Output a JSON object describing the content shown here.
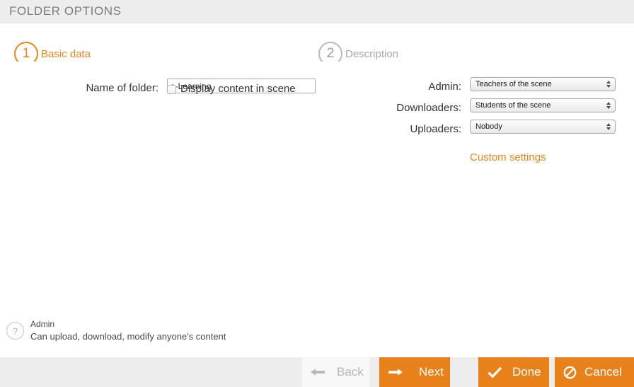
{
  "header": {
    "title": "FOLDER OPTIONS"
  },
  "steps": [
    {
      "number": "1",
      "label": "Basic data",
      "state": "active"
    },
    {
      "number": "2",
      "label": "Description",
      "state": "inactive"
    }
  ],
  "form": {
    "name_label": "Name of folder:",
    "name_value": "e-Learning",
    "name_placeholder": "",
    "display_checkbox_label": "Display content in scene",
    "display_checkbox_checked": false
  },
  "permissions": {
    "rows": [
      {
        "label": "Admin:",
        "value": "Teachers of the scene"
      },
      {
        "label": "Downloaders:",
        "value": "Students of the scene"
      },
      {
        "label": "Uploaders:",
        "value": "Nobody"
      }
    ],
    "custom_settings_link": "Custom settings"
  },
  "help": {
    "icon": "question-mark-icon",
    "title": "Admin",
    "description": "Can upload, download, modify anyone's content"
  },
  "footer": {
    "buttons": [
      {
        "label": "Back",
        "icon": "arrow-left-icon",
        "glyph": "←",
        "state": "disabled"
      },
      {
        "label": "Next",
        "icon": "arrow-right-icon",
        "glyph": "→",
        "state": "enabled"
      },
      {
        "label": "Done",
        "icon": "check-icon",
        "glyph": "✔",
        "state": "enabled"
      },
      {
        "label": "Cancel",
        "icon": "no-entry-icon",
        "glyph": "⊘",
        "state": "enabled"
      }
    ]
  },
  "colors": {
    "accent": "#e8861e",
    "button": "#e8811a",
    "header_bg": "#ededed",
    "footer_bg": "#ededed",
    "inactive": "#a8a8a8"
  }
}
